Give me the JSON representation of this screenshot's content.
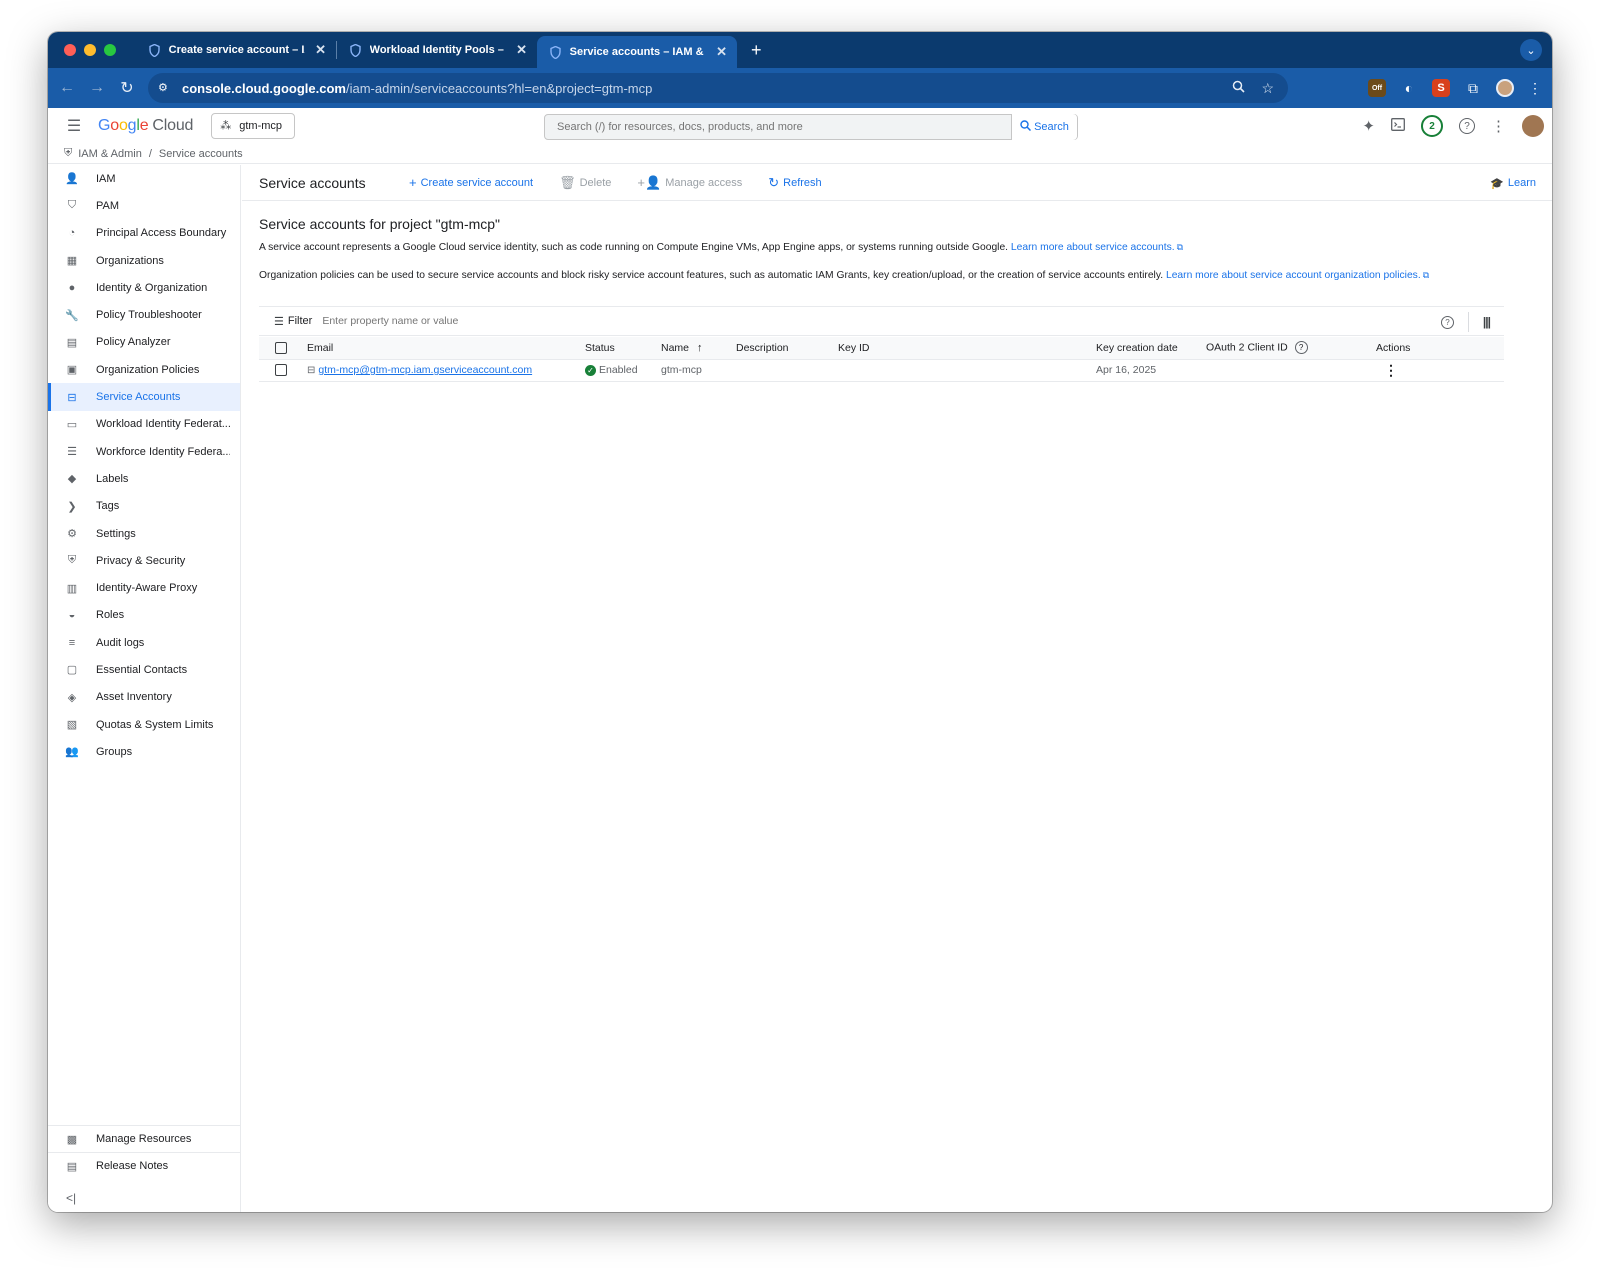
{
  "browser": {
    "tabs": [
      {
        "title": "Create service account – IAM & Admin",
        "active": false
      },
      {
        "title": "Workload Identity Pools – IAM & Admin",
        "active": false
      },
      {
        "title": "Service accounts – IAM & Admin",
        "active": true
      }
    ],
    "new_tab": "+",
    "url_host": "console.cloud.google.com",
    "url_path": "/iam-admin/serviceaccounts?hl=en&project=gtm-mcp",
    "ext_off_label": "Off",
    "ext_s_label": "S"
  },
  "header": {
    "logo": {
      "g1": "G",
      "o1": "o",
      "o2": "o",
      "g2": "g",
      "l": "l",
      "e": "e",
      "cloud": "Cloud"
    },
    "project": "gtm-mcp",
    "search_placeholder": "Search (/) for resources, docs, products, and more",
    "search_button": "Search",
    "notifications_count": "2"
  },
  "breadcrumb": {
    "parent": "IAM & Admin",
    "separator": "/",
    "current": "Service accounts"
  },
  "sidebar": {
    "items": [
      {
        "label": "IAM",
        "icon": "person-add-icon"
      },
      {
        "label": "PAM",
        "icon": "shield-lock-icon"
      },
      {
        "label": "Principal Access Boundary",
        "icon": "boundary-icon"
      },
      {
        "label": "Organizations",
        "icon": "building-icon"
      },
      {
        "label": "Identity & Organization",
        "icon": "account-circle-icon"
      },
      {
        "label": "Policy Troubleshooter",
        "icon": "wrench-icon"
      },
      {
        "label": "Policy Analyzer",
        "icon": "document-search-icon"
      },
      {
        "label": "Organization Policies",
        "icon": "policy-doc-icon"
      },
      {
        "label": "Service Accounts",
        "icon": "service-account-icon",
        "active": true
      },
      {
        "label": "Workload Identity Federat...",
        "icon": "id-card-icon"
      },
      {
        "label": "Workforce Identity Federa...",
        "icon": "list-icon"
      },
      {
        "label": "Labels",
        "icon": "label-icon"
      },
      {
        "label": "Tags",
        "icon": "tag-chevron-icon"
      },
      {
        "label": "Settings",
        "icon": "gear-icon"
      },
      {
        "label": "Privacy & Security",
        "icon": "shield-icon"
      },
      {
        "label": "Identity-Aware Proxy",
        "icon": "proxy-icon"
      },
      {
        "label": "Roles",
        "icon": "hat-icon"
      },
      {
        "label": "Audit logs",
        "icon": "lines-icon"
      },
      {
        "label": "Essential Contacts",
        "icon": "contact-card-icon"
      },
      {
        "label": "Asset Inventory",
        "icon": "diamond-icon"
      },
      {
        "label": "Quotas & System Limits",
        "icon": "quota-icon"
      },
      {
        "label": "Groups",
        "icon": "group-icon"
      }
    ],
    "bottom_items": [
      {
        "label": "Manage Resources",
        "icon": "folder-gear-icon"
      },
      {
        "label": "Release Notes",
        "icon": "notes-icon"
      }
    ],
    "collapse_label": "<|"
  },
  "toolbar": {
    "title": "Service accounts",
    "create": "Create service account",
    "delete": "Delete",
    "manage_access": "Manage access",
    "refresh": "Refresh",
    "learn": "Learn"
  },
  "main": {
    "heading": "Service accounts for project \"gtm-mcp\"",
    "intro": "A service account represents a Google Cloud service identity, such as code running on Compute Engine VMs, App Engine apps, or systems running outside Google. ",
    "intro_link": "Learn more about service accounts.",
    "org_text": "Organization policies can be used to secure service accounts and block risky service account features, such as automatic IAM Grants, key creation/upload, or the creation of service accounts entirely. ",
    "org_link": "Learn more about service account organization policies."
  },
  "filter": {
    "label": "Filter",
    "placeholder": "Enter property name or value"
  },
  "table": {
    "columns": [
      "Email",
      "Status",
      "Name",
      "Description",
      "Key ID",
      "Key creation date",
      "OAuth 2 Client ID",
      "Actions"
    ],
    "sort_indicator": "↑",
    "rows": [
      {
        "email": "gtm-mcp@gtm-mcp.iam.gserviceaccount.com",
        "status": "Enabled",
        "name": "gtm-mcp",
        "description": "",
        "key_id": "",
        "key_creation_date": "Apr 16, 2025",
        "oauth_client_id": ""
      }
    ]
  },
  "colors": {
    "accent": "#1a73e8",
    "tab_strip": "#0b3a6e",
    "address_bar": "#1a5ca8",
    "status_enabled": "#188038"
  }
}
